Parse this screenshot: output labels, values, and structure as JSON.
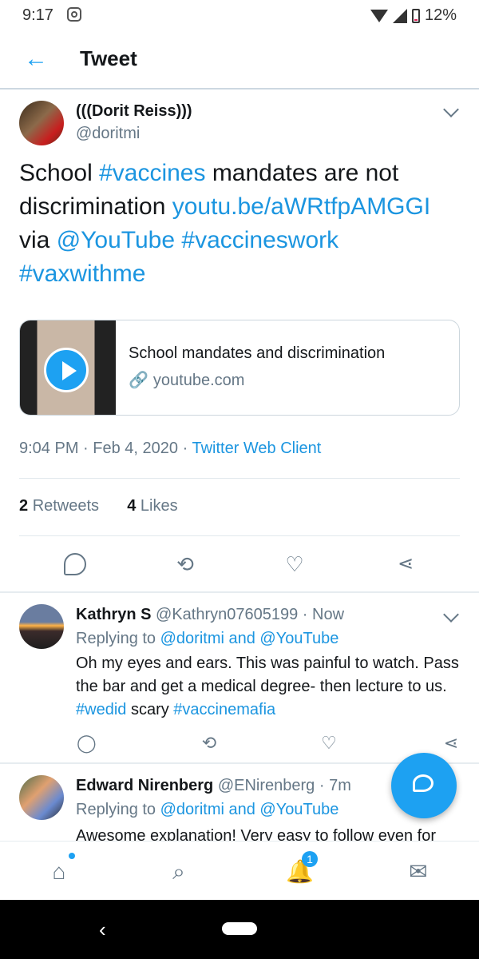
{
  "status": {
    "time": "9:17",
    "battery": "12%"
  },
  "appbar": {
    "title": "Tweet"
  },
  "tweet": {
    "name": "(((Dorit Reiss)))",
    "handle": "@doritmi",
    "text_parts": [
      "School ",
      "#vaccines",
      " mandates are not discrimination ",
      "youtu.be/aWRtfpAMGGI",
      " via ",
      "@YouTube",
      " ",
      "#vaccineswork",
      " ",
      "#vaxwithme"
    ],
    "card": {
      "title": "School mandates and discrimination",
      "domain": "youtube.com"
    },
    "time": "9:04 PM · Feb 4, 2020",
    "dot": "·",
    "client": "Twitter Web Client",
    "retweets_count": "2",
    "retweets_label": "Retweets",
    "likes_count": "4",
    "likes_label": "Likes"
  },
  "replies": [
    {
      "name": "Kathryn S",
      "meta": "@Kathryn07605199 · Now",
      "replying_prefix": "Replying to ",
      "replying_to": "@doritmi and @YouTube",
      "text_parts": [
        "Oh my eyes and ears. This was painful to watch. Pass the bar and get a medical degree- then lecture to us. ",
        "#wedid",
        " scary ",
        "#vaccinemafia"
      ]
    },
    {
      "name": "Edward Nirenberg",
      "meta": "@ENirenberg · 7m",
      "replying_prefix": "Replying to ",
      "replying_to": "@doritmi and @YouTube",
      "text": "Awesome explanation! Very easy to follow even for"
    }
  ],
  "bottomnav": {
    "notifications_badge": "1"
  },
  "icons": {
    "back": "arrow-left-icon",
    "reply": "comment-icon",
    "retweet": "retweet-icon",
    "like": "heart-icon",
    "share": "share-icon",
    "home": "home-icon",
    "search": "search-icon",
    "notifications": "bell-icon",
    "messages": "mail-icon",
    "compose": "compose-icon"
  },
  "colors": {
    "accent": "#1da1f2",
    "link": "#1b95e0",
    "muted": "#657786",
    "text": "#14171a"
  }
}
